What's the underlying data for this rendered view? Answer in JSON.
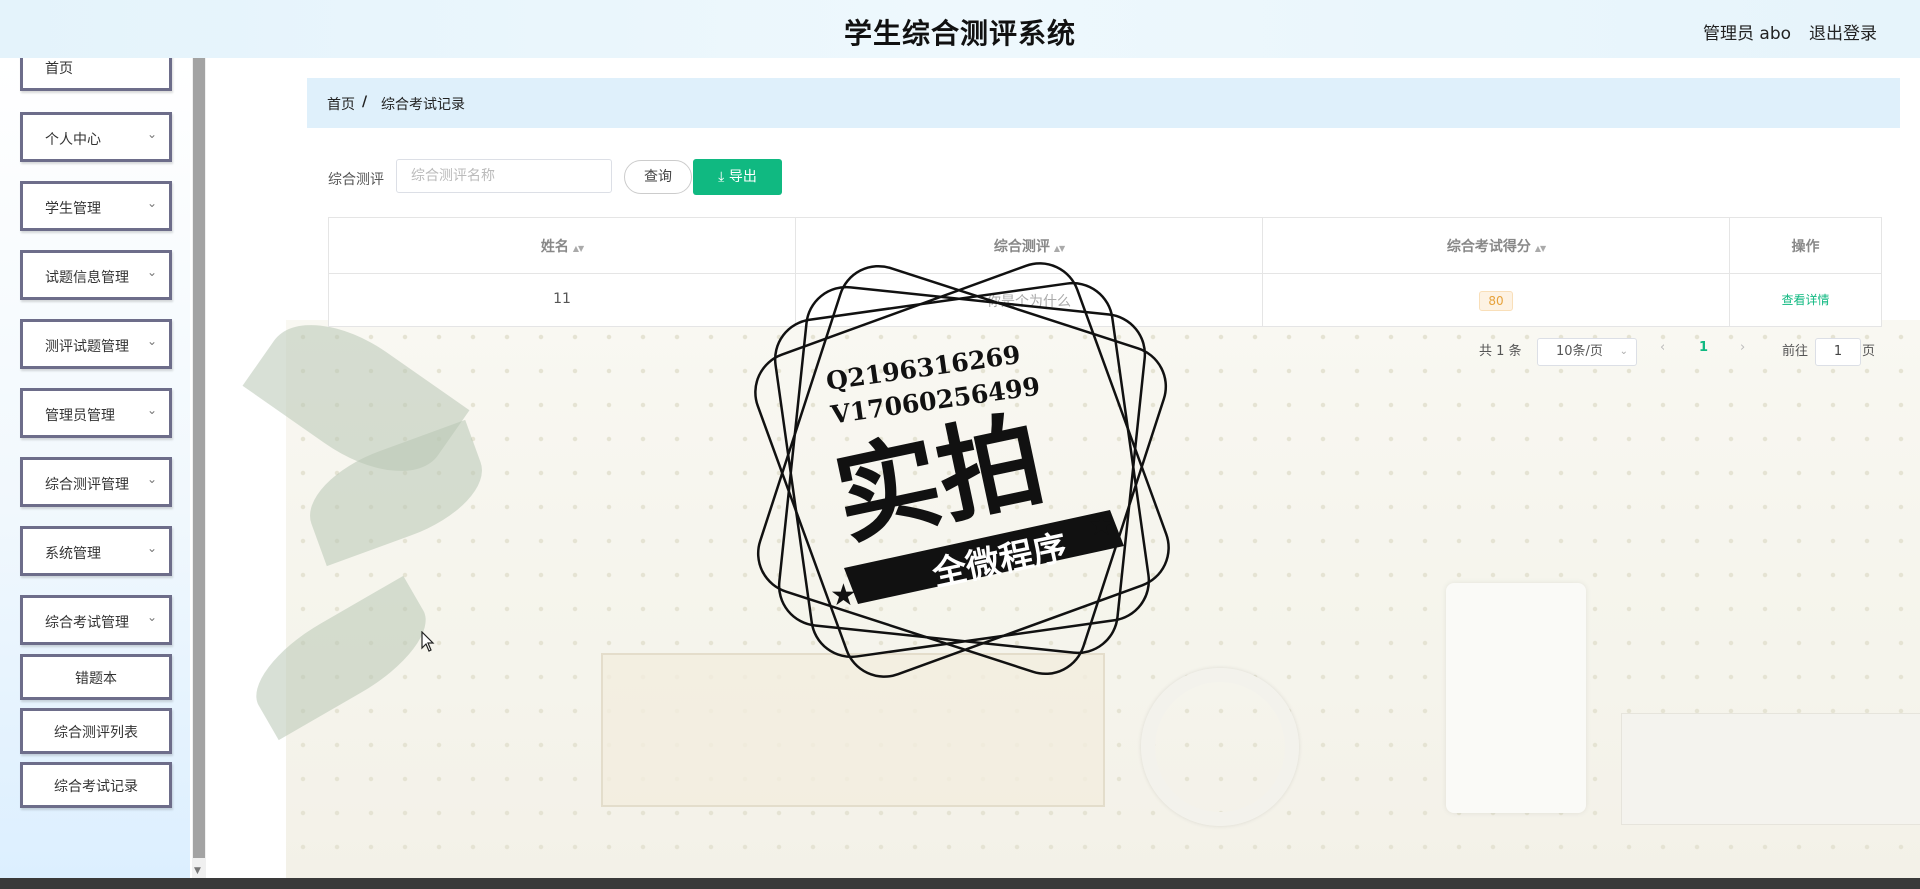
{
  "header": {
    "title": "学生综合测评系统",
    "user_label": "管理员 abo",
    "logout_label": "退出登录"
  },
  "sidebar": {
    "items": [
      {
        "label": "首页",
        "has_chevron": false
      },
      {
        "label": "个人中心",
        "has_chevron": true
      },
      {
        "label": "学生管理",
        "has_chevron": true
      },
      {
        "label": "试题信息管理",
        "has_chevron": true
      },
      {
        "label": "测评试题管理",
        "has_chevron": true
      },
      {
        "label": "管理员管理",
        "has_chevron": true
      },
      {
        "label": "综合测评管理",
        "has_chevron": true
      },
      {
        "label": "系统管理",
        "has_chevron": true
      },
      {
        "label": "综合考试管理",
        "has_chevron": true
      }
    ],
    "sub_items": [
      {
        "label": "错题本"
      },
      {
        "label": "综合测评列表"
      },
      {
        "label": "综合考试记录"
      }
    ]
  },
  "breadcrumb": {
    "home": "首页",
    "separator": "/",
    "current": "综合考试记录"
  },
  "filter": {
    "label": "综合测评",
    "placeholder": "综合测评名称",
    "value": "",
    "query_label": "查询",
    "export_label": "导出"
  },
  "table": {
    "columns": [
      "姓名",
      "综合测评",
      "综合考试得分",
      "操作"
    ],
    "rows": [
      {
        "name": "11",
        "assessment": "你是个为什么",
        "score": "80",
        "action": "查看详情"
      }
    ]
  },
  "pagination": {
    "total": "共 1 条",
    "page_size": "10条/页",
    "current_page": "1",
    "goto_prefix": "前往",
    "goto_value": "1",
    "goto_suffix": "页"
  },
  "watermark": {
    "line1": "Q2196316269",
    "line2": "V17060256499",
    "main": "实拍",
    "banner": "全微程序"
  },
  "colors": {
    "accent": "#10b981",
    "header_bg": "#e4f3fb",
    "breadcrumb_bg": "#dff0fb",
    "menu_border": "#6d6d8a",
    "score_tag": "#e6a23c"
  }
}
